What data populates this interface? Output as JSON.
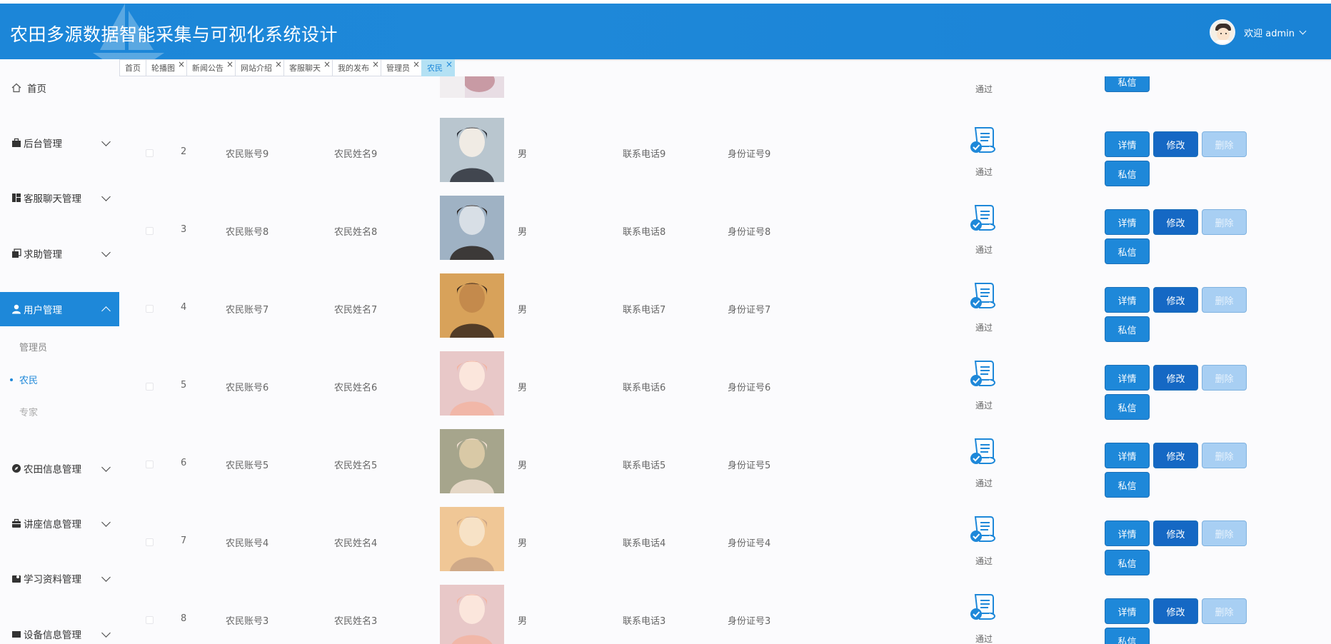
{
  "header": {
    "title": "农田多源数据智能采集与可视化系统设计",
    "welcome": "欢迎 admin"
  },
  "sidebar": {
    "items": [
      {
        "label": "首页",
        "icon": "home-icon"
      },
      {
        "label": "后台管理",
        "icon": "briefcase-icon"
      },
      {
        "label": "客服聊天管理",
        "icon": "dashboard-icon"
      },
      {
        "label": "求助管理",
        "icon": "copy-icon"
      },
      {
        "label": "用户管理",
        "icon": "user-icon"
      },
      {
        "label": "农田信息管理",
        "icon": "compass-icon"
      },
      {
        "label": "讲座信息管理",
        "icon": "suitcase-icon"
      },
      {
        "label": "学习资料管理",
        "icon": "camera-icon"
      },
      {
        "label": "设备信息管理",
        "icon": "device-icon"
      }
    ],
    "user_sub": [
      "管理员",
      "农民",
      "专家"
    ]
  },
  "tabs": [
    "首页",
    "轮播图",
    "新闻公告",
    "网站介绍",
    "客服聊天",
    "我的发布",
    "管理员",
    "农民"
  ],
  "actions": {
    "detail": "详情",
    "edit": "修改",
    "delete": "删除",
    "message": "私信"
  },
  "first_row": {
    "status": "通过"
  },
  "rows": [
    {
      "index": "2",
      "account": "农民账号9",
      "name": "农民姓名9",
      "gender": "男",
      "phone": "联系电话9",
      "idcard": "身份证号9",
      "status": "通过"
    },
    {
      "index": "3",
      "account": "农民账号8",
      "name": "农民姓名8",
      "gender": "男",
      "phone": "联系电话8",
      "idcard": "身份证号8",
      "status": "通过"
    },
    {
      "index": "4",
      "account": "农民账号7",
      "name": "农民姓名7",
      "gender": "男",
      "phone": "联系电话7",
      "idcard": "身份证号7",
      "status": "通过"
    },
    {
      "index": "5",
      "account": "农民账号6",
      "name": "农民姓名6",
      "gender": "男",
      "phone": "联系电话6",
      "idcard": "身份证号6",
      "status": "通过"
    },
    {
      "index": "6",
      "account": "农民账号5",
      "name": "农民姓名5",
      "gender": "男",
      "phone": "联系电话5",
      "idcard": "身份证号5",
      "status": "通过"
    },
    {
      "index": "7",
      "account": "农民账号4",
      "name": "农民姓名4",
      "gender": "男",
      "phone": "联系电话4",
      "idcard": "身份证号4",
      "status": "通过"
    },
    {
      "index": "8",
      "account": "农民账号3",
      "name": "农民姓名3",
      "gender": "男",
      "phone": "联系电话3",
      "idcard": "身份证号3",
      "status": "通过"
    }
  ],
  "colors": {
    "primary": "#1e88d9",
    "edit": "#1568c4",
    "delete_disabled": "#a8cff3",
    "active_tab": "#b4e1f4"
  }
}
